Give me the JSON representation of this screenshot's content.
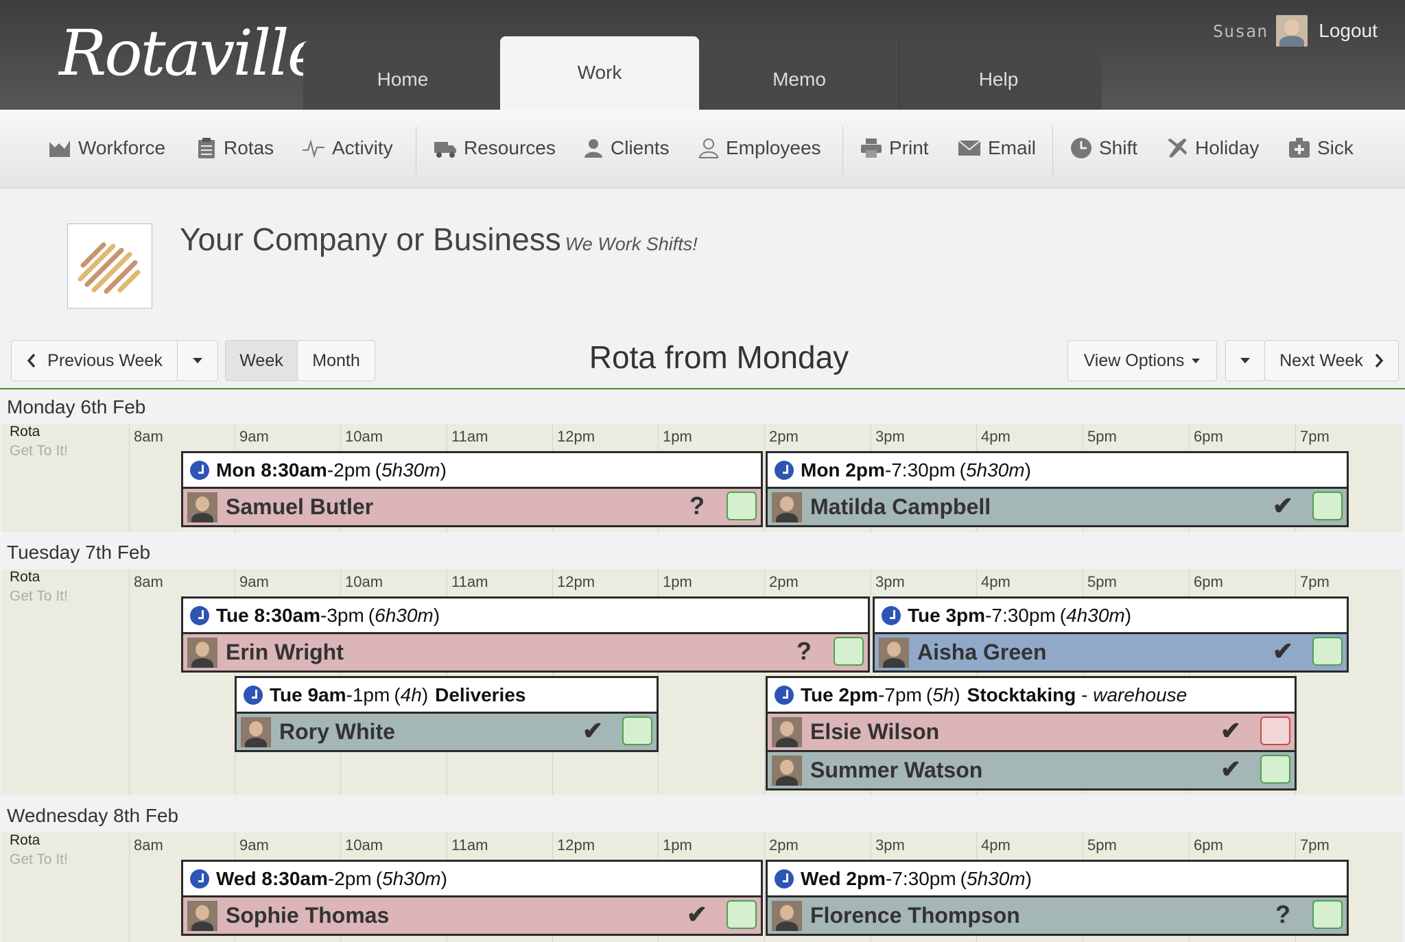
{
  "app": {
    "logo": "Rotaville",
    "user": "Susan",
    "logout": "Logout"
  },
  "nav": {
    "tabs": [
      {
        "label": "Home"
      },
      {
        "label": "Work",
        "active": true
      },
      {
        "label": "Memo"
      },
      {
        "label": "Help"
      }
    ]
  },
  "toolbar": {
    "items": [
      {
        "label": "Workforce",
        "icon": "chart-icon"
      },
      {
        "label": "Rotas",
        "icon": "clipboard-icon"
      },
      {
        "label": "Activity",
        "icon": "pulse-icon"
      },
      {
        "label": "Resources",
        "icon": "truck-icon"
      },
      {
        "label": "Clients",
        "icon": "client-icon"
      },
      {
        "label": "Employees",
        "icon": "user-icon"
      },
      {
        "label": "Print",
        "icon": "printer-icon"
      },
      {
        "label": "Email",
        "icon": "envelope-icon"
      },
      {
        "label": "Shift",
        "icon": "clock-icon"
      },
      {
        "label": "Holiday",
        "icon": "plane-icon"
      },
      {
        "label": "Sick",
        "icon": "medical-icon"
      }
    ]
  },
  "company": {
    "name": "Your Company or Business",
    "tagline": "We Work Shifts!"
  },
  "controls": {
    "prev": "Previous Week",
    "week": "Week",
    "month": "Month",
    "title": "Rota from Monday",
    "view_options": "View Options",
    "next": "Next Week"
  },
  "grid": {
    "hours": [
      "8am",
      "9am",
      "10am",
      "11am",
      "12pm",
      "1pm",
      "2pm",
      "3pm",
      "4pm",
      "5pm",
      "6pm",
      "7pm"
    ],
    "row_label": "Rota",
    "row_sublabel": "Get To It!"
  },
  "days": [
    {
      "name": "Monday 6th Feb",
      "shifts": [
        {
          "start": "Mon 8:30am",
          "end": "-2pm",
          "dur": "5h30m",
          "people": [
            {
              "name": "Samuel Butler",
              "status": "?",
              "color": "pink",
              "box": "green"
            }
          ]
        },
        {
          "start": "Mon 2pm",
          "end": "-7:30pm",
          "dur": "5h30m",
          "people": [
            {
              "name": "Matilda Campbell",
              "status": "✔",
              "color": "teal",
              "box": "green"
            }
          ]
        }
      ]
    },
    {
      "name": "Tuesday 7th Feb",
      "shifts": [
        {
          "start": "Tue 8:30am",
          "end": "-3pm",
          "dur": "6h30m",
          "people": [
            {
              "name": "Erin Wright",
              "status": "?",
              "color": "pink",
              "box": "green"
            }
          ]
        },
        {
          "start": "Tue 3pm",
          "end": "-7:30pm",
          "dur": "4h30m",
          "people": [
            {
              "name": "Aisha Green",
              "status": "✔",
              "color": "blue",
              "box": "green"
            }
          ]
        },
        {
          "start": "Tue 9am",
          "end": "-1pm",
          "dur": "4h",
          "extra": "Deliveries",
          "people": [
            {
              "name": "Rory White",
              "status": "✔",
              "color": "teal",
              "box": "green"
            }
          ]
        },
        {
          "start": "Tue 2pm",
          "end": "-7pm",
          "dur": "5h",
          "extra": "Stocktaking",
          "location": "warehouse",
          "people": [
            {
              "name": "Elsie Wilson",
              "status": "✔",
              "color": "pink",
              "box": "red"
            },
            {
              "name": "Summer Watson",
              "status": "✔",
              "color": "teal",
              "box": "green"
            }
          ]
        }
      ]
    },
    {
      "name": "Wednesday 8th Feb",
      "shifts": [
        {
          "start": "Wed 8:30am",
          "end": "-2pm",
          "dur": "5h30m",
          "people": [
            {
              "name": "Sophie Thomas",
              "status": "✔",
              "color": "pink",
              "box": "green"
            }
          ]
        },
        {
          "start": "Wed 2pm",
          "end": "-7:30pm",
          "dur": "5h30m",
          "people": [
            {
              "name": "Florence Thompson",
              "status": "?",
              "color": "teal",
              "box": "green"
            }
          ]
        }
      ]
    }
  ],
  "colors": {
    "pink": "#dbb5b8",
    "teal": "#a4b6b5",
    "blue": "#90a9c8",
    "clock": "#2d55b4",
    "accent_line": "#4a8a3a"
  }
}
